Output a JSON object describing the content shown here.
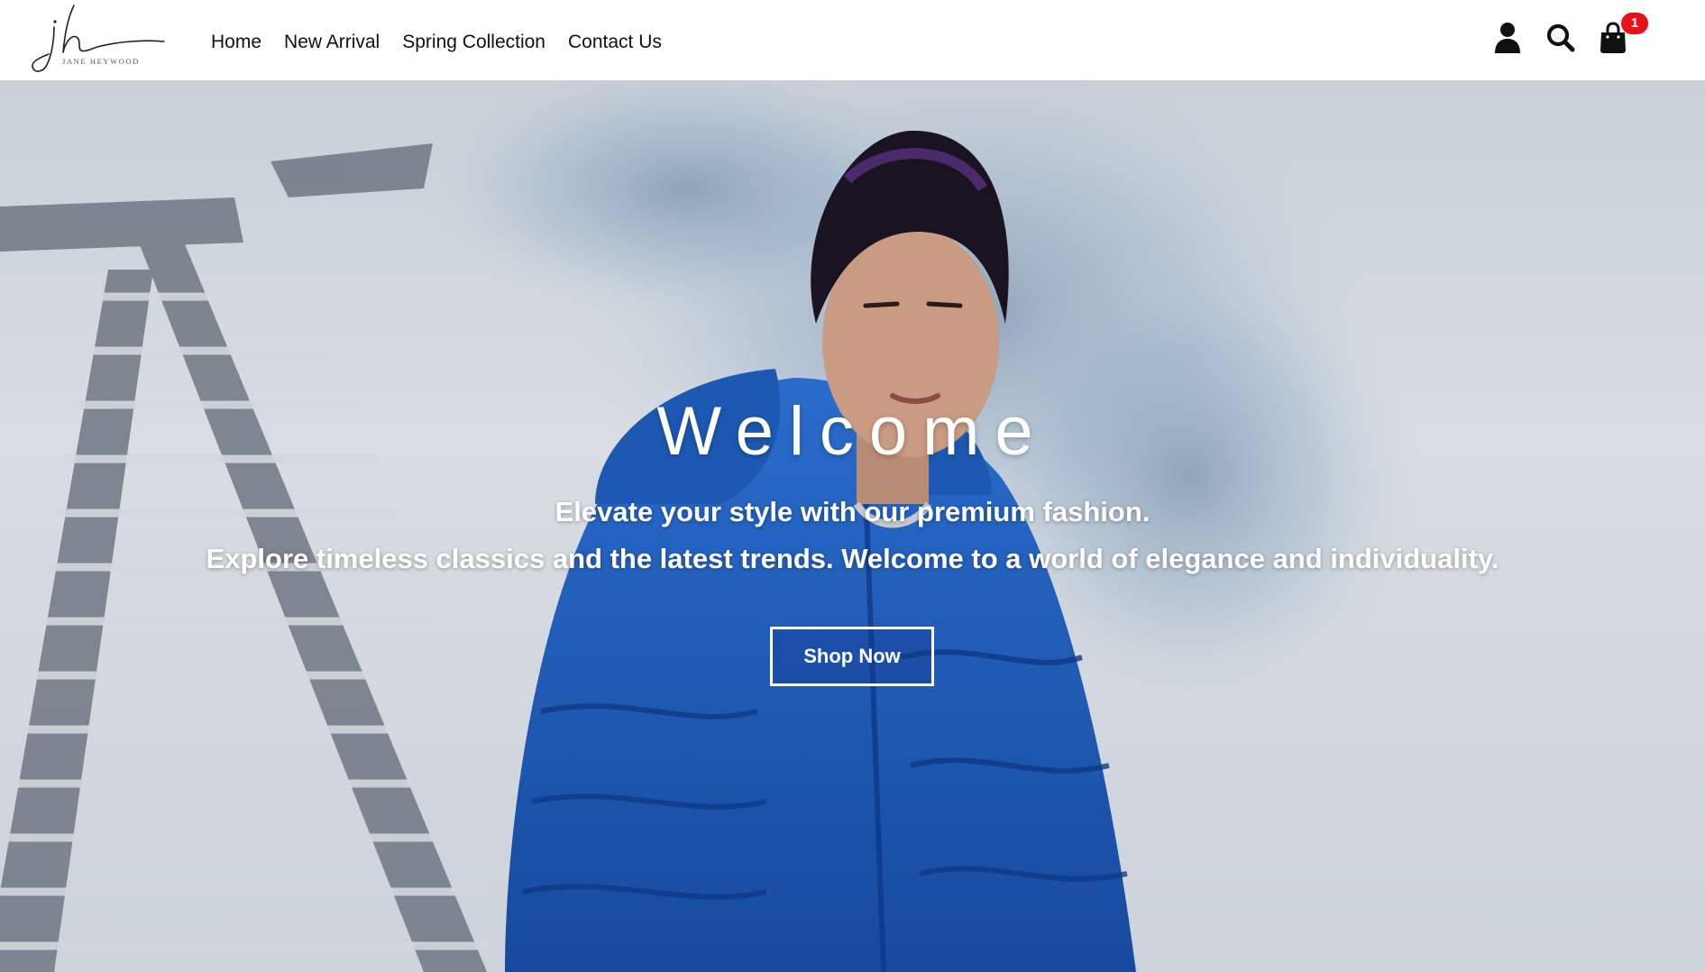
{
  "brand": {
    "logo_monogram": "jh",
    "logo_caption": "JANE HEYWOOD"
  },
  "nav": {
    "items": [
      {
        "label": "Home"
      },
      {
        "label": "New Arrival"
      },
      {
        "label": "Spring Collection"
      },
      {
        "label": "Contact Us"
      }
    ]
  },
  "header_icons": {
    "account": "user-icon",
    "search": "search-icon",
    "cart": "shopping-bag-icon",
    "cart_count": "1",
    "badge_color": "#e8111a"
  },
  "hero": {
    "title": "Welcome",
    "tagline_line1": "Elevate your style with our premium fashion.",
    "tagline_line2": "Explore timeless classics and the latest trends. Welcome to a world of elegance and individuality.",
    "cta_label": "Shop Now",
    "jacket_color": "#1f5fbf"
  }
}
